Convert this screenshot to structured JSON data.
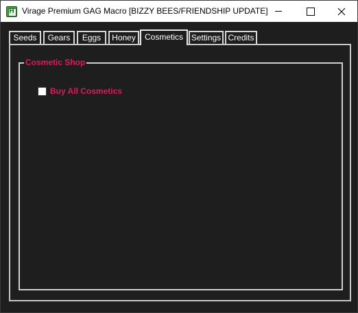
{
  "window": {
    "title": "Virage Premium GAG Macro [BIZZY BEES/FRIENDSHIP UPDATE]",
    "icon": "app-h-icon",
    "controls": [
      "minimize",
      "maximize",
      "close"
    ]
  },
  "tabs": [
    {
      "label": "Seeds",
      "active": false
    },
    {
      "label": "Gears",
      "active": false
    },
    {
      "label": "Eggs",
      "active": false
    },
    {
      "label": "Honey",
      "active": false
    },
    {
      "label": "Cosmetics",
      "active": true
    },
    {
      "label": "Settings",
      "active": false
    },
    {
      "label": "Credits",
      "active": false
    }
  ],
  "cosmetic_shop": {
    "group_title": "Cosmetic Shop",
    "buy_all": {
      "label": "Buy All Cosmetics",
      "checked": false
    }
  },
  "colors": {
    "background": "#1e1e1e",
    "accent": "#e0185c",
    "text": "#ffffff",
    "border": "#d0d0d0"
  }
}
